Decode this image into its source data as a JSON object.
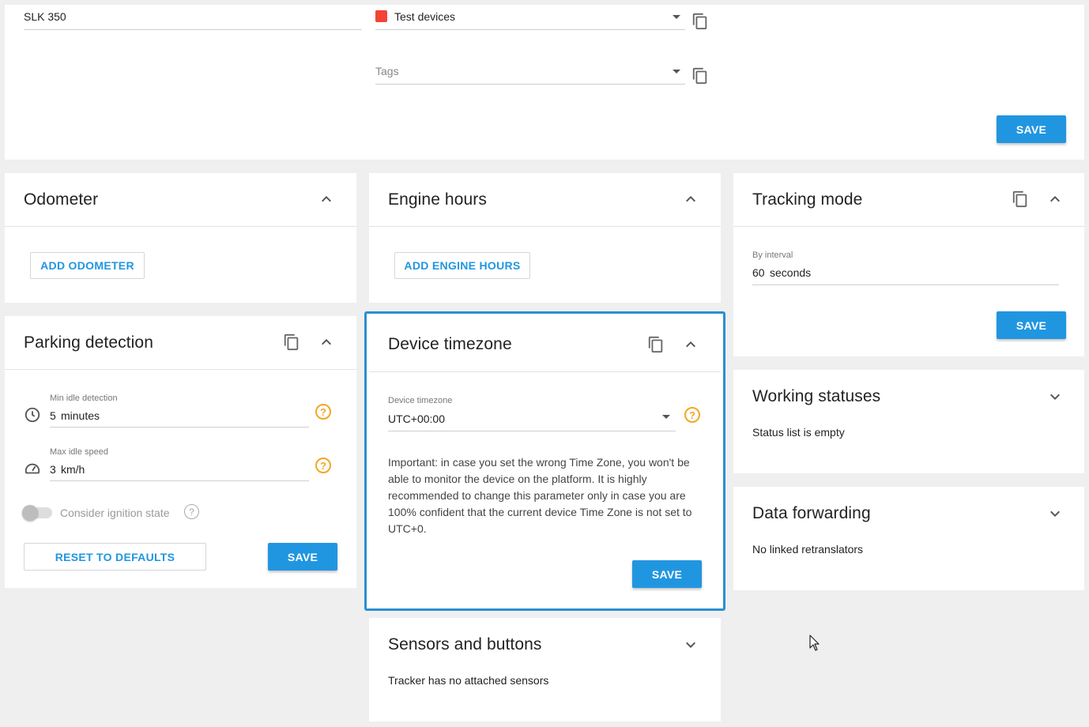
{
  "top_card": {
    "device_name": "SLK 350",
    "group_name": "Test devices",
    "group_color": "#f44336",
    "tags_placeholder": "Tags",
    "save_label": "SAVE"
  },
  "odometer": {
    "title": "Odometer",
    "add_label": "ADD ODOMETER"
  },
  "engine_hours": {
    "title": "Engine hours",
    "add_label": "ADD ENGINE HOURS"
  },
  "tracking_mode": {
    "title": "Tracking mode",
    "interval_label": "By interval",
    "interval_value": "60",
    "interval_unit": "seconds",
    "save_label": "SAVE"
  },
  "parking_detection": {
    "title": "Parking detection",
    "min_idle_label": "Min idle detection",
    "min_idle_value": "5",
    "min_idle_unit": "minutes",
    "max_speed_label": "Max idle speed",
    "max_speed_value": "3",
    "max_speed_unit": "km/h",
    "ignition_label": "Consider ignition state",
    "reset_label": "RESET TO DEFAULTS",
    "save_label": "SAVE"
  },
  "device_timezone": {
    "title": "Device timezone",
    "field_label": "Device timezone",
    "field_value": "UTC+00:00",
    "warning_text": "Important: in case you set the wrong Time Zone, you won't be able to monitor the device on the platform. It is highly recommended to change this parameter only in case you are 100% confident that the current device Time Zone is not set to UTC+0.",
    "save_label": "SAVE"
  },
  "working_statuses": {
    "title": "Working statuses",
    "empty_text": "Status list is empty"
  },
  "data_forwarding": {
    "title": "Data forwarding",
    "empty_text": "No linked retranslators"
  },
  "sensors": {
    "title": "Sensors and buttons",
    "empty_text": "Tracker has no attached sensors"
  },
  "colors": {
    "accent": "#2196e0",
    "help": "#f5a623",
    "focus_border": "#2b8fd0"
  },
  "icons": [
    "copy-icon",
    "chevron-up-icon",
    "chevron-down-icon",
    "help-icon",
    "clock-icon",
    "speedometer-icon",
    "mouse-cursor-icon"
  ]
}
